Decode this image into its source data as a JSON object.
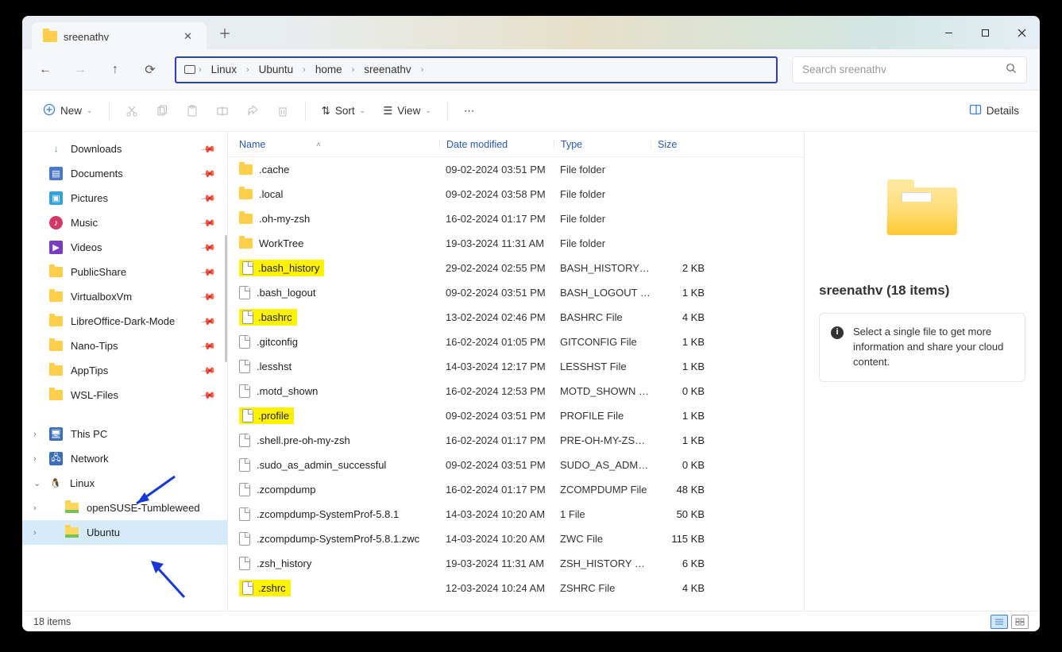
{
  "tab": {
    "title": "sreenathv"
  },
  "breadcrumb": [
    "Linux",
    "Ubuntu",
    "home",
    "sreenathv"
  ],
  "search": {
    "placeholder": "Search sreenathv"
  },
  "toolbar": {
    "new_label": "New",
    "sort_label": "Sort",
    "view_label": "View",
    "details_label": "Details"
  },
  "sidebar": {
    "quick": [
      {
        "label": "Downloads",
        "icon": "dl"
      },
      {
        "label": "Documents",
        "icon": "doc"
      },
      {
        "label": "Pictures",
        "icon": "pic"
      },
      {
        "label": "Music",
        "icon": "mus"
      },
      {
        "label": "Videos",
        "icon": "vid"
      },
      {
        "label": "PublicShare",
        "icon": "folder"
      },
      {
        "label": "VirtualboxVm",
        "icon": "folder"
      },
      {
        "label": "LibreOffice-Dark-Mode",
        "icon": "folder"
      },
      {
        "label": "Nano-Tips",
        "icon": "folder"
      },
      {
        "label": "AppTips",
        "icon": "folder"
      },
      {
        "label": "WSL-Files",
        "icon": "folder"
      }
    ],
    "tree": [
      {
        "label": "This PC",
        "icon": "pc",
        "chev": "right"
      },
      {
        "label": "Network",
        "icon": "net",
        "chev": "right"
      },
      {
        "label": "Linux",
        "icon": "lin",
        "chev": "down"
      },
      {
        "label": "openSUSE-Tumbleweed",
        "icon": "folder-green",
        "chev": "right",
        "indent": true
      },
      {
        "label": "Ubuntu",
        "icon": "folder-green",
        "chev": "right",
        "indent": true,
        "selected": true
      }
    ]
  },
  "columns": {
    "name": "Name",
    "date": "Date modified",
    "type": "Type",
    "size": "Size"
  },
  "files": [
    {
      "name": ".cache",
      "date": "09-02-2024 03:51 PM",
      "type": "File folder",
      "size": "",
      "kind": "folder",
      "hl": false
    },
    {
      "name": ".local",
      "date": "09-02-2024 03:58 PM",
      "type": "File folder",
      "size": "",
      "kind": "folder",
      "hl": false
    },
    {
      "name": ".oh-my-zsh",
      "date": "16-02-2024 01:17 PM",
      "type": "File folder",
      "size": "",
      "kind": "folder",
      "hl": false
    },
    {
      "name": "WorkTree",
      "date": "19-03-2024 11:31 AM",
      "type": "File folder",
      "size": "",
      "kind": "folder",
      "hl": false
    },
    {
      "name": ".bash_history",
      "date": "29-02-2024 02:55 PM",
      "type": "BASH_HISTORY File",
      "size": "2 KB",
      "kind": "file",
      "hl": true
    },
    {
      "name": ".bash_logout",
      "date": "09-02-2024 03:51 PM",
      "type": "BASH_LOGOUT File",
      "size": "1 KB",
      "kind": "file",
      "hl": false
    },
    {
      "name": ".bashrc",
      "date": "13-02-2024 02:46 PM",
      "type": "BASHRC File",
      "size": "4 KB",
      "kind": "file",
      "hl": true
    },
    {
      "name": ".gitconfig",
      "date": "16-02-2024 01:05 PM",
      "type": "GITCONFIG File",
      "size": "1 KB",
      "kind": "file",
      "hl": false
    },
    {
      "name": ".lesshst",
      "date": "14-03-2024 12:17 PM",
      "type": "LESSHST File",
      "size": "1 KB",
      "kind": "file",
      "hl": false
    },
    {
      "name": ".motd_shown",
      "date": "16-02-2024 12:53 PM",
      "type": "MOTD_SHOWN File",
      "size": "0 KB",
      "kind": "file",
      "hl": false
    },
    {
      "name": ".profile",
      "date": "09-02-2024 03:51 PM",
      "type": "PROFILE File",
      "size": "1 KB",
      "kind": "file",
      "hl": true
    },
    {
      "name": ".shell.pre-oh-my-zsh",
      "date": "16-02-2024 01:17 PM",
      "type": "PRE-OH-MY-ZSH ...",
      "size": "1 KB",
      "kind": "file",
      "hl": false
    },
    {
      "name": ".sudo_as_admin_successful",
      "date": "09-02-2024 03:51 PM",
      "type": "SUDO_AS_ADMIN...",
      "size": "0 KB",
      "kind": "file",
      "hl": false
    },
    {
      "name": ".zcompdump",
      "date": "16-02-2024 01:17 PM",
      "type": "ZCOMPDUMP File",
      "size": "48 KB",
      "kind": "file",
      "hl": false
    },
    {
      "name": ".zcompdump-SystemProf-5.8.1",
      "date": "14-03-2024 10:20 AM",
      "type": "1 File",
      "size": "50 KB",
      "kind": "file",
      "hl": false
    },
    {
      "name": ".zcompdump-SystemProf-5.8.1.zwc",
      "date": "14-03-2024 10:20 AM",
      "type": "ZWC File",
      "size": "115 KB",
      "kind": "file",
      "hl": false
    },
    {
      "name": ".zsh_history",
      "date": "19-03-2024 11:31 AM",
      "type": "ZSH_HISTORY File",
      "size": "6 KB",
      "kind": "file",
      "hl": false
    },
    {
      "name": ".zshrc",
      "date": "12-03-2024 10:24 AM",
      "type": "ZSHRC File",
      "size": "4 KB",
      "kind": "file",
      "hl": true
    }
  ],
  "details": {
    "title": "sreenathv (18 items)",
    "info": "Select a single file to get more information and share your cloud content."
  },
  "status": {
    "text": "18 items"
  }
}
